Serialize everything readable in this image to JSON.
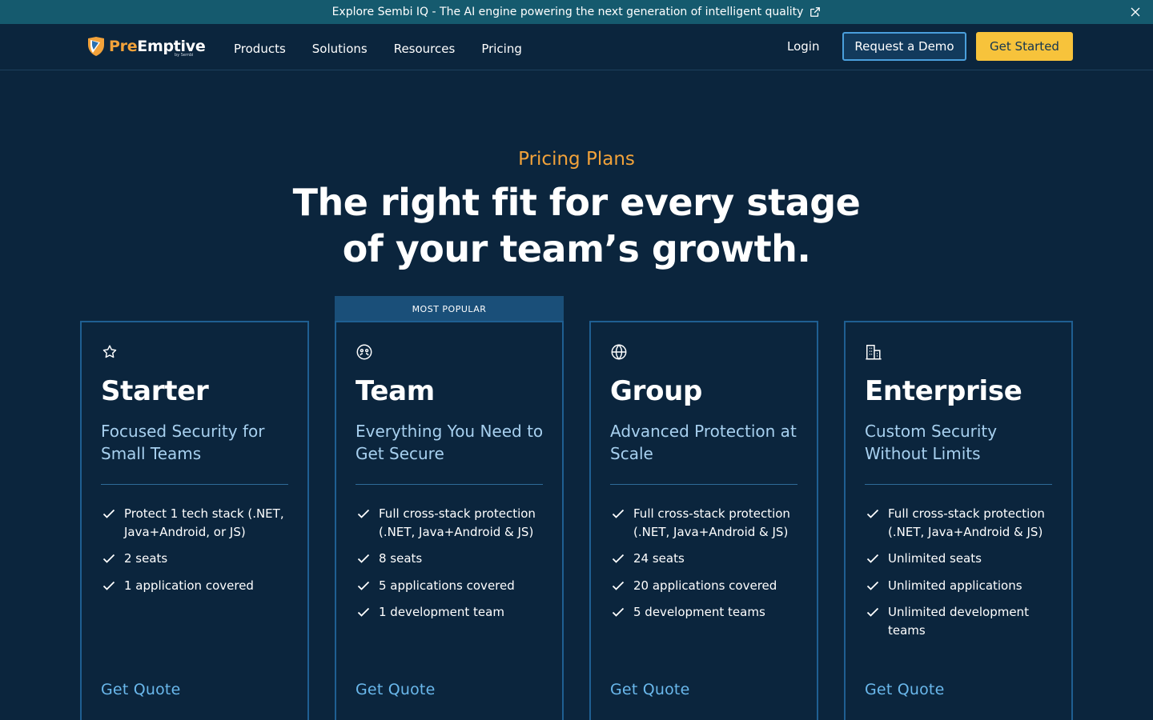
{
  "announcement": {
    "text": "Explore Sembi IQ - The AI engine powering the next generation of intelligent quality",
    "external_icon": "external-link-icon",
    "close_icon": "close-icon"
  },
  "header": {
    "logo": {
      "pre": "Pre",
      "emptive": "Emptive",
      "sub": "by Sembi"
    },
    "nav": [
      "Products",
      "Solutions",
      "Resources",
      "Pricing"
    ],
    "login": "Login",
    "demo_button": "Request a Demo",
    "start_button": "Get Started"
  },
  "hero": {
    "eyebrow": "Pricing Plans",
    "headline": "The right fit for every stage of your team’s growth."
  },
  "popular_badge": "MOST POPULAR",
  "plans": [
    {
      "icon": "star-icon",
      "title": "Starter",
      "subtitle": "Focused Security for Small Teams",
      "features": [
        "Protect 1 tech stack (.NET, Java+Android, or JS)",
        "2 seats",
        "1 application covered"
      ],
      "cta": "Get Quote"
    },
    {
      "icon": "team-icon",
      "title": "Team",
      "subtitle": "Everything You Need to Get Secure",
      "features": [
        "Full cross-stack protection (.NET, Java+Android & JS)",
        "8 seats",
        "5 applications covered",
        "1 development team"
      ],
      "cta": "Get Quote"
    },
    {
      "icon": "globe-icon",
      "title": "Group",
      "subtitle": "Advanced Protection at Scale",
      "features": [
        "Full cross-stack protection (.NET, Java+Android & JS)",
        "24 seats",
        "20 applications covered",
        "5 development teams"
      ],
      "cta": "Get Quote"
    },
    {
      "icon": "building-icon",
      "title": "Enterprise",
      "subtitle": "Custom Security Without Limits",
      "features": [
        "Full cross-stack protection (.NET, Java+Android & JS)",
        "Unlimited seats",
        "Unlimited applications",
        "Unlimited development teams"
      ],
      "cta": "Get Quote"
    }
  ],
  "colors": {
    "background": "#0b253d",
    "accent_orange": "#f2a23a",
    "accent_yellow": "#f7c33b",
    "link_blue": "#6ab8ec",
    "card_border": "#1f5f92"
  }
}
